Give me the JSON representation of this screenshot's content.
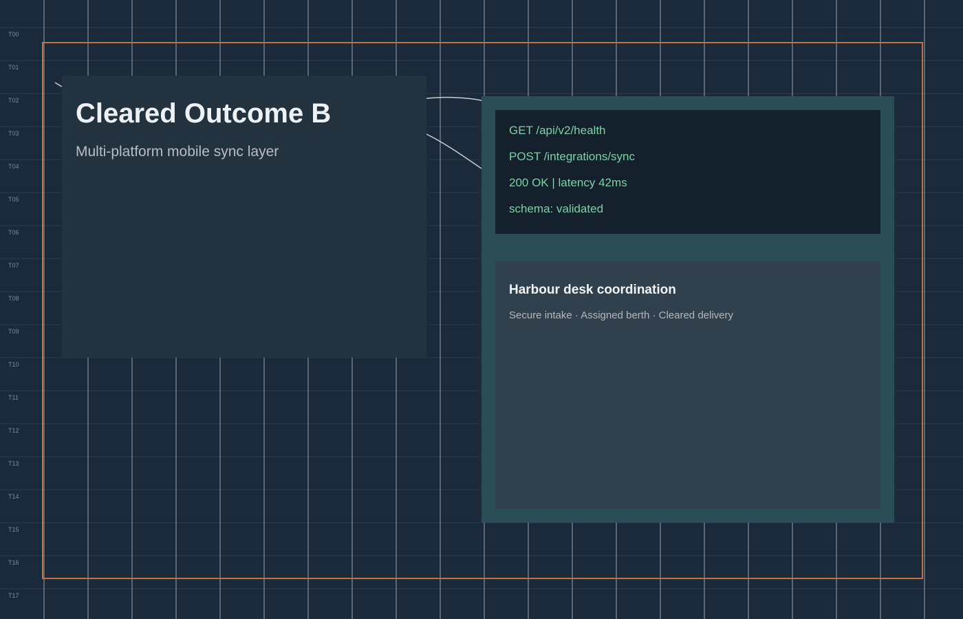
{
  "row_labels": [
    "T00",
    "T01",
    "T02",
    "T03",
    "T04",
    "T05",
    "T06",
    "T07",
    "T08",
    "T09",
    "T10",
    "T11",
    "T12",
    "T13",
    "T14",
    "T15",
    "T16",
    "T17"
  ],
  "hero": {
    "title": "Cleared Outcome B",
    "subtitle": "Multi-platform mobile sync layer"
  },
  "console": {
    "lines": [
      "GET /api/v2/health",
      "POST /integrations/sync",
      "200 OK | latency 42ms",
      "schema: validated"
    ]
  },
  "info_card": {
    "title": "Harbour desk coordination",
    "subtitle": "Secure intake · Assigned berth · Cleared delivery"
  },
  "colors": {
    "background": "#1b2a3b",
    "frame_border": "#c8713f",
    "hero_card": "#22323f",
    "panel": "#2b4d56",
    "console_bg": "#14212c",
    "console_text": "#7fd0a6",
    "info_card": "#30404d"
  }
}
